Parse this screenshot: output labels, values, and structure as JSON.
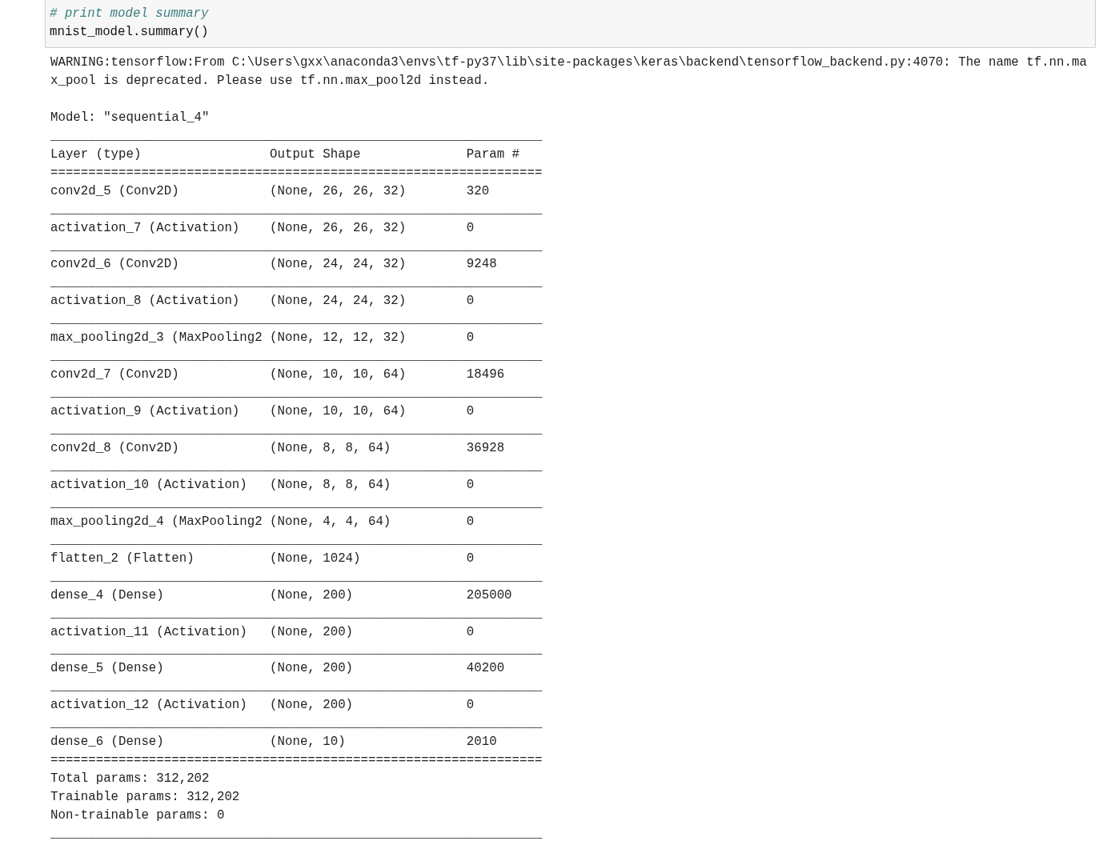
{
  "code_cell": {
    "lines": [
      {
        "kind": "comment",
        "text": "# print model summary"
      },
      {
        "kind": "code",
        "text": "mnist_model.summary()"
      }
    ]
  },
  "output": {
    "warning": "WARNING:tensorflow:From C:\\Users\\gxx\\anaconda3\\envs\\tf-py37\\lib\\site-packages\\keras\\backend\\tensorflow_backend.py:4070: The name tf.nn.max_pool is deprecated. Please use tf.nn.max_pool2d instead.",
    "model_name": "Model: \"sequential_4\"",
    "summary": [
      {
        "kind": "rule",
        "text": "_________________________________________________________________"
      },
      {
        "kind": "header",
        "cells": [
          "Layer (type)",
          "Output Shape",
          "Param #"
        ]
      },
      {
        "kind": "rule",
        "text": "================================================================="
      },
      {
        "kind": "row",
        "cells": [
          "conv2d_5 (Conv2D)",
          "(None, 26, 26, 32)",
          "320"
        ]
      },
      {
        "kind": "rule",
        "text": "_________________________________________________________________"
      },
      {
        "kind": "row",
        "cells": [
          "activation_7 (Activation)",
          "(None, 26, 26, 32)",
          "0"
        ]
      },
      {
        "kind": "rule",
        "text": "_________________________________________________________________"
      },
      {
        "kind": "row",
        "cells": [
          "conv2d_6 (Conv2D)",
          "(None, 24, 24, 32)",
          "9248"
        ]
      },
      {
        "kind": "rule",
        "text": "_________________________________________________________________"
      },
      {
        "kind": "row",
        "cells": [
          "activation_8 (Activation)",
          "(None, 24, 24, 32)",
          "0"
        ]
      },
      {
        "kind": "rule",
        "text": "_________________________________________________________________"
      },
      {
        "kind": "row",
        "cells": [
          "max_pooling2d_3 (MaxPooling2",
          "(None, 12, 12, 32)",
          "0"
        ]
      },
      {
        "kind": "rule",
        "text": "_________________________________________________________________"
      },
      {
        "kind": "row",
        "cells": [
          "conv2d_7 (Conv2D)",
          "(None, 10, 10, 64)",
          "18496"
        ]
      },
      {
        "kind": "rule",
        "text": "_________________________________________________________________"
      },
      {
        "kind": "row",
        "cells": [
          "activation_9 (Activation)",
          "(None, 10, 10, 64)",
          "0"
        ]
      },
      {
        "kind": "rule",
        "text": "_________________________________________________________________"
      },
      {
        "kind": "row",
        "cells": [
          "conv2d_8 (Conv2D)",
          "(None, 8, 8, 64)",
          "36928"
        ]
      },
      {
        "kind": "rule",
        "text": "_________________________________________________________________"
      },
      {
        "kind": "row",
        "cells": [
          "activation_10 (Activation)",
          "(None, 8, 8, 64)",
          "0"
        ]
      },
      {
        "kind": "rule",
        "text": "_________________________________________________________________"
      },
      {
        "kind": "row",
        "cells": [
          "max_pooling2d_4 (MaxPooling2",
          "(None, 4, 4, 64)",
          "0"
        ]
      },
      {
        "kind": "rule",
        "text": "_________________________________________________________________"
      },
      {
        "kind": "row",
        "cells": [
          "flatten_2 (Flatten)",
          "(None, 1024)",
          "0"
        ]
      },
      {
        "kind": "rule",
        "text": "_________________________________________________________________"
      },
      {
        "kind": "row",
        "cells": [
          "dense_4 (Dense)",
          "(None, 200)",
          "205000"
        ]
      },
      {
        "kind": "rule",
        "text": "_________________________________________________________________"
      },
      {
        "kind": "row",
        "cells": [
          "activation_11 (Activation)",
          "(None, 200)",
          "0"
        ]
      },
      {
        "kind": "rule",
        "text": "_________________________________________________________________"
      },
      {
        "kind": "row",
        "cells": [
          "dense_5 (Dense)",
          "(None, 200)",
          "40200"
        ]
      },
      {
        "kind": "rule",
        "text": "_________________________________________________________________"
      },
      {
        "kind": "row",
        "cells": [
          "activation_12 (Activation)",
          "(None, 200)",
          "0"
        ]
      },
      {
        "kind": "rule",
        "text": "_________________________________________________________________"
      },
      {
        "kind": "row",
        "cells": [
          "dense_6 (Dense)",
          "(None, 10)",
          "2010"
        ]
      },
      {
        "kind": "rule",
        "text": "================================================================="
      },
      {
        "kind": "text",
        "text": "Total params: 312,202"
      },
      {
        "kind": "text",
        "text": "Trainable params: 312,202"
      },
      {
        "kind": "text",
        "text": "Non-trainable params: 0"
      },
      {
        "kind": "rule",
        "text": "_________________________________________________________________"
      }
    ]
  }
}
